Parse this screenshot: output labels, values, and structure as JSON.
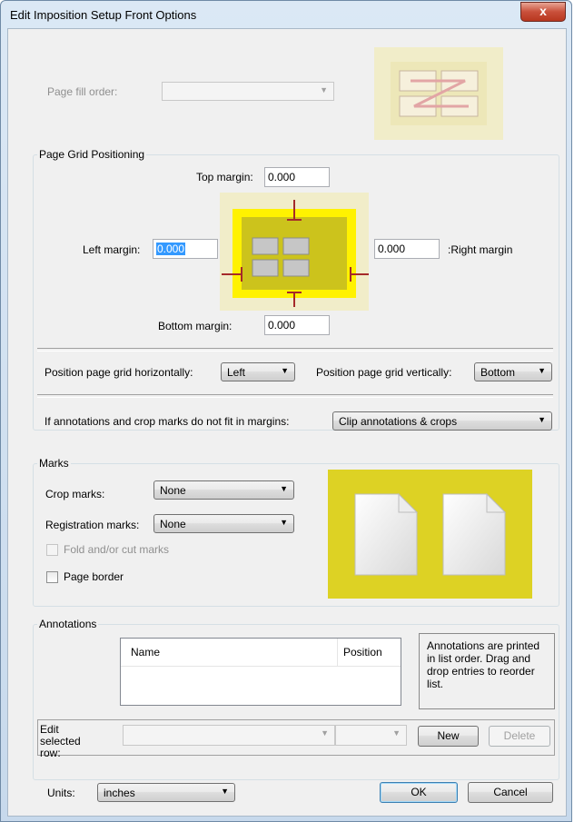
{
  "window": {
    "title": "Edit Imposition Setup Front Options",
    "close_glyph": "x"
  },
  "page_fill": {
    "label": "Page fill order:",
    "value": ""
  },
  "grid_group": {
    "title": "Page Grid Positioning",
    "top_margin_label": "Top margin:",
    "top_margin_value": "0.000",
    "left_margin_label": "Left margin:",
    "left_margin_value": "0.000",
    "right_margin_label": ":Right margin",
    "right_margin_value": "0.000",
    "bottom_margin_label": "Bottom margin:",
    "bottom_margin_value": "0.000",
    "horiz_label": "Position page grid horizontally:",
    "horiz_value": "Left",
    "vert_label": "Position page grid vertically:",
    "vert_value": "Bottom",
    "annot_fit_label": "If annotations and crop marks do not fit in margins:",
    "annot_fit_value": "Clip annotations & crops"
  },
  "marks_group": {
    "title": "Marks",
    "crop_label": "Crop marks:",
    "crop_value": "None",
    "reg_label": "Registration marks:",
    "reg_value": "None",
    "fold_label": "Fold and/or cut marks",
    "border_label": "Page border"
  },
  "annotations_group": {
    "title": "Annotations",
    "columns": [
      "Name",
      "Position"
    ],
    "rows": [],
    "hint": "Annotations are printed in list order.  Drag and drop entries to reorder list.",
    "edit_row_label": "Edit selected row:",
    "new_label": "New",
    "delete_label": "Delete"
  },
  "footer": {
    "units_label": "Units:",
    "units_value": "inches",
    "ok_label": "OK",
    "cancel_label": "Cancel"
  },
  "colors": {
    "yellow_bg": "#ddd224",
    "grid_yellow": "#fff200",
    "grid_olive": "#ccc31c",
    "margin_arrow": "#a52a2a"
  }
}
